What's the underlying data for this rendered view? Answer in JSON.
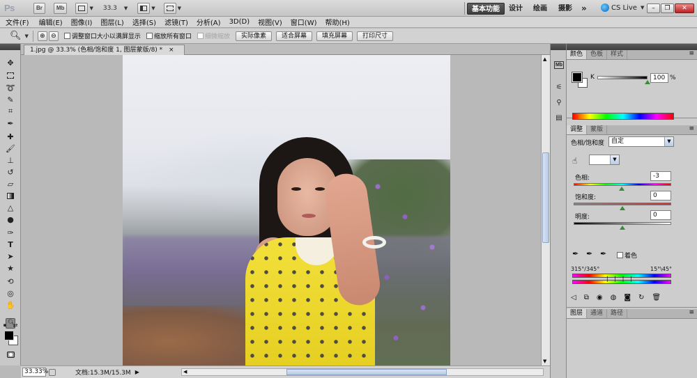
{
  "appbar": {
    "logo": "Ps",
    "bridge_label": "Br",
    "minibridge_label": "Mb",
    "zoom": "33.3",
    "workspaces": [
      "基本功能",
      "设计",
      "绘画",
      "摄影"
    ],
    "more": "»",
    "cslive": "CS Live"
  },
  "menu": [
    "文件(F)",
    "编辑(E)",
    "图像(I)",
    "图层(L)",
    "选择(S)",
    "滤镜(T)",
    "分析(A)",
    "3D(D)",
    "视图(V)",
    "窗口(W)",
    "帮助(H)"
  ],
  "options": {
    "resize_windows": "调整窗口大小以满屏显示",
    "zoom_all": "缩放所有窗口",
    "scrubby_zoom": "细微缩放",
    "actual_pixels": "实际像素",
    "fit_screen": "适合屏幕",
    "fill_screen": "填充屏幕",
    "print_size": "打印尺寸"
  },
  "document": {
    "tab_title": "1.jpg @ 33.3% (色相/饱和度 1, 图层蒙版/8) *",
    "close": "×"
  },
  "status": {
    "zoom": "33.33%",
    "doc_info": "文档:15.3M/15.3M"
  },
  "color_panel": {
    "tabs": [
      "颜色",
      "色板",
      "样式"
    ],
    "channel_label": "K",
    "value": "100",
    "unit": "%"
  },
  "adjust_panel": {
    "tabs": [
      "调整",
      "蒙版"
    ],
    "title": "色相/饱和度",
    "preset": "自定",
    "channel": "",
    "hue_label": "色相:",
    "hue_value": "-3",
    "sat_label": "饱和度:",
    "sat_value": "0",
    "light_label": "明度:",
    "light_value": "0",
    "colorize_label": "着色",
    "range_left": "315°/345°",
    "range_right": "15°\\45°"
  },
  "layers_panel": {
    "tabs": [
      "图层",
      "通道",
      "路径"
    ]
  }
}
